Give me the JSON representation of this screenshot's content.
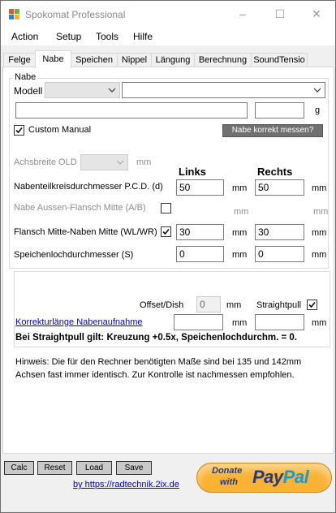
{
  "window": {
    "title": "Spokomat Professional",
    "controls": [
      "–",
      "☐",
      "✕"
    ]
  },
  "menu": [
    "Action",
    "Setup",
    "Tools",
    "Hilfe"
  ],
  "tabs": [
    "Felge",
    "Nabe",
    "Speichen",
    "Nippel",
    "Längung",
    "Berechnung",
    "SoundTensio"
  ],
  "active_tab": "Nabe",
  "nabe": {
    "group_label": "Nabe",
    "modell_label": "Modell",
    "modell_value_1": "",
    "modell_value_2": "",
    "name_value": "",
    "weight_value": "",
    "weight_unit": "g",
    "custom_manual_label": "Custom Manual",
    "custom_manual_checked": true,
    "measure_button": "Nabe korrekt messen?",
    "achsbreite_label": "Achsbreite OLD",
    "achsbreite_unit": "mm",
    "col_links": "Links",
    "col_rechts": "Rechts",
    "rows": [
      {
        "label": "Nabenteilkreisdurchmesser P.C.D. (d)",
        "left": "50",
        "right": "50",
        "unit": "mm"
      },
      {
        "label": "Nabe Aussen-Flansch Mitte (A/B)",
        "left": "",
        "right": "",
        "unit": "mm"
      },
      {
        "label": "Flansch Mitte-Naben Mitte (WL/WR)",
        "left": "30",
        "right": "30",
        "unit": "mm"
      },
      {
        "label": "Speichenlochdurchmesser (S)",
        "left": "0",
        "right": "0",
        "unit": "mm"
      }
    ]
  },
  "dish": {
    "offset_label": "Offset/Dish",
    "offset_value": "0",
    "offset_unit": "mm",
    "straightpull_label": "Straightpull",
    "straightpull_checked": true,
    "korrektur_link": "Korrekturlänge Nabenaufnahme",
    "korrektur_left": "",
    "korrektur_right": "",
    "unit": "mm",
    "straightpull_note": "Bei Straightpull gilt: Kreuzung +0.5x, Speichenlochdurchm. = 0."
  },
  "hinweis_line1": "Hinweis: Die für den Rechner benötigten Maße sind bei 135 und 142mm",
  "hinweis_line2": "Achsen fast immer identisch. Zur Kontrolle ist nachmessen empfohlen.",
  "bottom_buttons": [
    "Calc",
    "Reset",
    "Load",
    "Save"
  ],
  "credit_link": "by https://radtechnik.2ix.de",
  "paypal": {
    "donate": "Donate",
    "with": "with",
    "brand": "PayPal"
  },
  "colors": {
    "accent": "#0078d7",
    "link": "#0000cc",
    "paypal_gold": "#f9b233",
    "paypal_blue": "#253b80",
    "paypal_lightblue": "#179bd7"
  }
}
